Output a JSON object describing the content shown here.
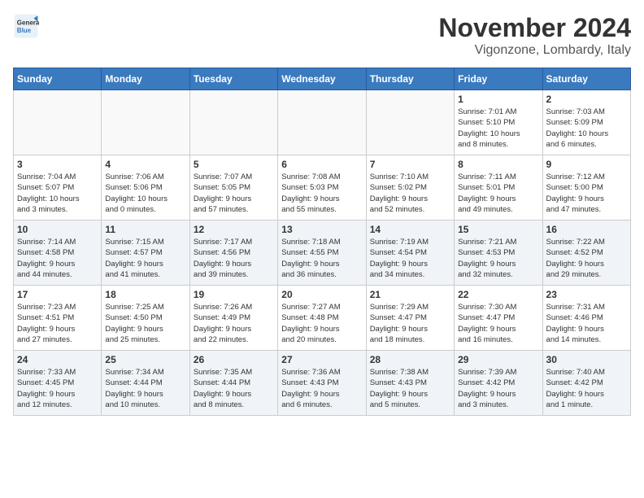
{
  "header": {
    "logo_general": "General",
    "logo_blue": "Blue",
    "title": "November 2024",
    "subtitle": "Vigonzone, Lombardy, Italy"
  },
  "days_of_week": [
    "Sunday",
    "Monday",
    "Tuesday",
    "Wednesday",
    "Thursday",
    "Friday",
    "Saturday"
  ],
  "weeks": [
    [
      {
        "day": "",
        "info": ""
      },
      {
        "day": "",
        "info": ""
      },
      {
        "day": "",
        "info": ""
      },
      {
        "day": "",
        "info": ""
      },
      {
        "day": "",
        "info": ""
      },
      {
        "day": "1",
        "info": "Sunrise: 7:01 AM\nSunset: 5:10 PM\nDaylight: 10 hours\nand 8 minutes."
      },
      {
        "day": "2",
        "info": "Sunrise: 7:03 AM\nSunset: 5:09 PM\nDaylight: 10 hours\nand 6 minutes."
      }
    ],
    [
      {
        "day": "3",
        "info": "Sunrise: 7:04 AM\nSunset: 5:07 PM\nDaylight: 10 hours\nand 3 minutes."
      },
      {
        "day": "4",
        "info": "Sunrise: 7:06 AM\nSunset: 5:06 PM\nDaylight: 10 hours\nand 0 minutes."
      },
      {
        "day": "5",
        "info": "Sunrise: 7:07 AM\nSunset: 5:05 PM\nDaylight: 9 hours\nand 57 minutes."
      },
      {
        "day": "6",
        "info": "Sunrise: 7:08 AM\nSunset: 5:03 PM\nDaylight: 9 hours\nand 55 minutes."
      },
      {
        "day": "7",
        "info": "Sunrise: 7:10 AM\nSunset: 5:02 PM\nDaylight: 9 hours\nand 52 minutes."
      },
      {
        "day": "8",
        "info": "Sunrise: 7:11 AM\nSunset: 5:01 PM\nDaylight: 9 hours\nand 49 minutes."
      },
      {
        "day": "9",
        "info": "Sunrise: 7:12 AM\nSunset: 5:00 PM\nDaylight: 9 hours\nand 47 minutes."
      }
    ],
    [
      {
        "day": "10",
        "info": "Sunrise: 7:14 AM\nSunset: 4:58 PM\nDaylight: 9 hours\nand 44 minutes."
      },
      {
        "day": "11",
        "info": "Sunrise: 7:15 AM\nSunset: 4:57 PM\nDaylight: 9 hours\nand 41 minutes."
      },
      {
        "day": "12",
        "info": "Sunrise: 7:17 AM\nSunset: 4:56 PM\nDaylight: 9 hours\nand 39 minutes."
      },
      {
        "day": "13",
        "info": "Sunrise: 7:18 AM\nSunset: 4:55 PM\nDaylight: 9 hours\nand 36 minutes."
      },
      {
        "day": "14",
        "info": "Sunrise: 7:19 AM\nSunset: 4:54 PM\nDaylight: 9 hours\nand 34 minutes."
      },
      {
        "day": "15",
        "info": "Sunrise: 7:21 AM\nSunset: 4:53 PM\nDaylight: 9 hours\nand 32 minutes."
      },
      {
        "day": "16",
        "info": "Sunrise: 7:22 AM\nSunset: 4:52 PM\nDaylight: 9 hours\nand 29 minutes."
      }
    ],
    [
      {
        "day": "17",
        "info": "Sunrise: 7:23 AM\nSunset: 4:51 PM\nDaylight: 9 hours\nand 27 minutes."
      },
      {
        "day": "18",
        "info": "Sunrise: 7:25 AM\nSunset: 4:50 PM\nDaylight: 9 hours\nand 25 minutes."
      },
      {
        "day": "19",
        "info": "Sunrise: 7:26 AM\nSunset: 4:49 PM\nDaylight: 9 hours\nand 22 minutes."
      },
      {
        "day": "20",
        "info": "Sunrise: 7:27 AM\nSunset: 4:48 PM\nDaylight: 9 hours\nand 20 minutes."
      },
      {
        "day": "21",
        "info": "Sunrise: 7:29 AM\nSunset: 4:47 PM\nDaylight: 9 hours\nand 18 minutes."
      },
      {
        "day": "22",
        "info": "Sunrise: 7:30 AM\nSunset: 4:47 PM\nDaylight: 9 hours\nand 16 minutes."
      },
      {
        "day": "23",
        "info": "Sunrise: 7:31 AM\nSunset: 4:46 PM\nDaylight: 9 hours\nand 14 minutes."
      }
    ],
    [
      {
        "day": "24",
        "info": "Sunrise: 7:33 AM\nSunset: 4:45 PM\nDaylight: 9 hours\nand 12 minutes."
      },
      {
        "day": "25",
        "info": "Sunrise: 7:34 AM\nSunset: 4:44 PM\nDaylight: 9 hours\nand 10 minutes."
      },
      {
        "day": "26",
        "info": "Sunrise: 7:35 AM\nSunset: 4:44 PM\nDaylight: 9 hours\nand 8 minutes."
      },
      {
        "day": "27",
        "info": "Sunrise: 7:36 AM\nSunset: 4:43 PM\nDaylight: 9 hours\nand 6 minutes."
      },
      {
        "day": "28",
        "info": "Sunrise: 7:38 AM\nSunset: 4:43 PM\nDaylight: 9 hours\nand 5 minutes."
      },
      {
        "day": "29",
        "info": "Sunrise: 7:39 AM\nSunset: 4:42 PM\nDaylight: 9 hours\nand 3 minutes."
      },
      {
        "day": "30",
        "info": "Sunrise: 7:40 AM\nSunset: 4:42 PM\nDaylight: 9 hours\nand 1 minute."
      }
    ]
  ]
}
